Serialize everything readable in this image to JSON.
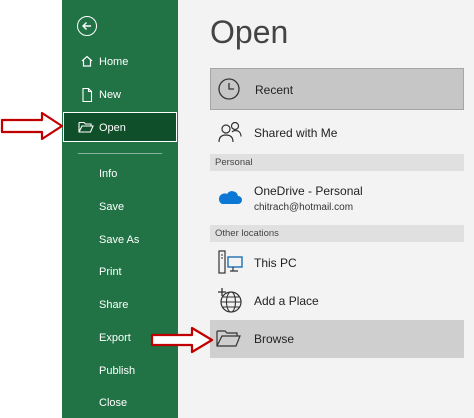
{
  "sidebar": {
    "items": [
      {
        "label": "Home",
        "icon": "home-icon"
      },
      {
        "label": "New",
        "icon": "new-document-icon"
      },
      {
        "label": "Open",
        "icon": "open-folder-icon"
      },
      {
        "label": "Info"
      },
      {
        "label": "Save"
      },
      {
        "label": "Save As"
      },
      {
        "label": "Print"
      },
      {
        "label": "Share"
      },
      {
        "label": "Export"
      },
      {
        "label": "Publish"
      },
      {
        "label": "Close"
      }
    ]
  },
  "main": {
    "title": "Open",
    "recent_label": "Recent",
    "shared_label": "Shared with Me",
    "personal_header": "Personal",
    "onedrive": {
      "label": "OneDrive - Personal",
      "email": "chitrach@hotmail.com"
    },
    "other_header": "Other locations",
    "this_pc_label": "This PC",
    "add_place_label": "Add a Place",
    "browse_label": "Browse"
  },
  "colors": {
    "sidebar": "#217346",
    "active": "#0f4f2a",
    "annotation_arrow": "#c00000",
    "onedrive": "#0a78d4"
  }
}
